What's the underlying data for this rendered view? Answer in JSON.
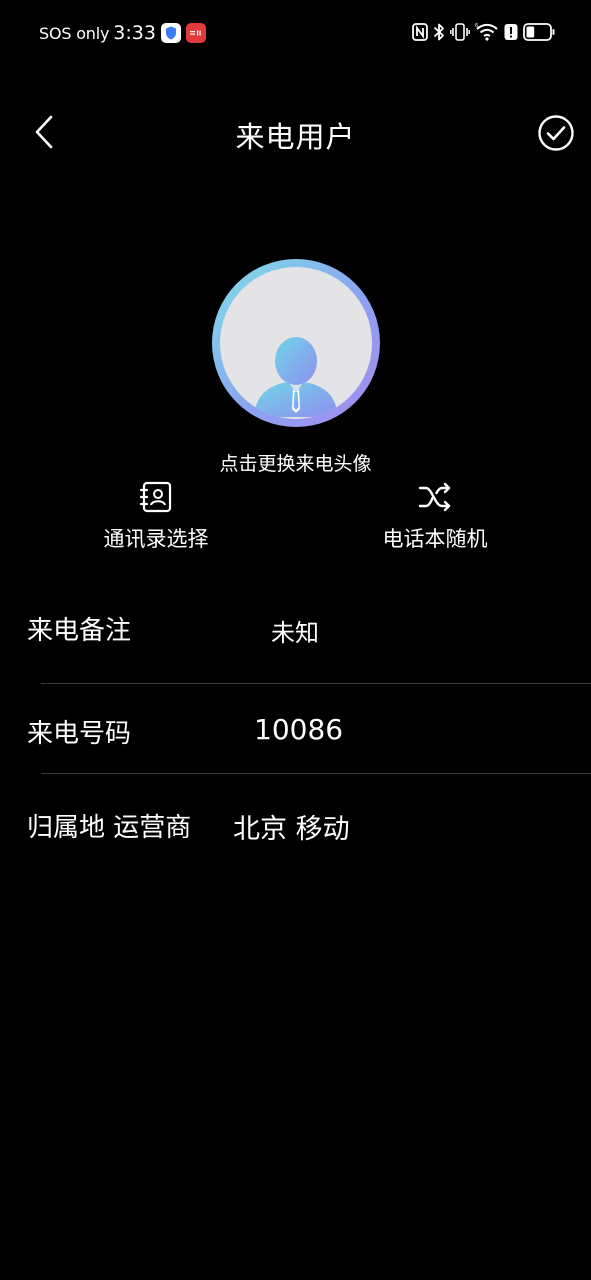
{
  "status_bar": {
    "sos": "SOS only",
    "time": "3:33",
    "icons": [
      "shield-app-icon",
      "red-app-icon",
      "nfc-icon",
      "bluetooth-icon",
      "vibrate-icon",
      "wifi-icon",
      "alert-icon",
      "battery-icon"
    ],
    "battery_level": 0.35
  },
  "header": {
    "title": "来电用户",
    "back_icon": "chevron-left-icon",
    "confirm_icon": "check-circle-icon"
  },
  "avatar": {
    "change_label": "点击更换来电头像",
    "icon": "user-avatar-icon"
  },
  "actions": {
    "contacts_label": "通讯录选择",
    "contacts_icon": "contact-book-icon",
    "random_label": "电话本随机",
    "random_icon": "shuffle-icon"
  },
  "form": {
    "note_label": "来电备注",
    "note_value": "未知",
    "number_label": "来电号码",
    "number_value": "10086",
    "location_label": "归属地 运营商",
    "location_value": "北京 移动"
  },
  "colors": {
    "background": "#000000",
    "text": "#ffffff",
    "divider": "#3a3a3a",
    "avatar_gradient_start": "#7fe0e8",
    "avatar_gradient_end": "#a88af0"
  }
}
